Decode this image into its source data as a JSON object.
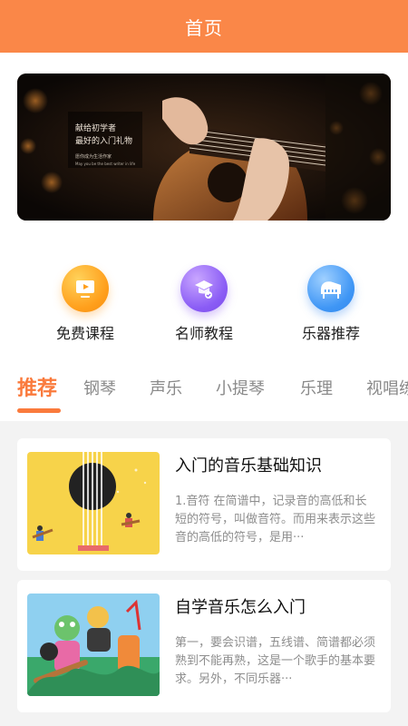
{
  "header": {
    "title": "首页"
  },
  "banner": {
    "line1": "献给初学者",
    "line2": "最好的入门礼物",
    "line3": "愿你成为生活作家",
    "line4": "May you be the best writer in life"
  },
  "categories": [
    {
      "label": "免费课程",
      "icon": "video-course-icon",
      "color": "#ffa11f"
    },
    {
      "label": "名师教程",
      "icon": "teacher-badge-icon",
      "color": "#8a5cf5"
    },
    {
      "label": "乐器推荐",
      "icon": "piano-icon",
      "color": "#3f96f5"
    }
  ],
  "tabs": [
    {
      "label": "推荐",
      "active": true
    },
    {
      "label": "钢琴"
    },
    {
      "label": "声乐"
    },
    {
      "label": "小提琴"
    },
    {
      "label": "乐理"
    },
    {
      "label": "视唱练"
    }
  ],
  "articles": [
    {
      "title": "入门的音乐基础知识",
      "desc": "1.音符 在简谱中，记录音的高低和长短的符号，叫做音符。而用来表示这些音的高低的符号，是用···"
    },
    {
      "title": "自学音乐怎么入门",
      "desc": "第一，要会识谱，五线谱、简谱都必须熟到不能再熟，这是一个歌手的基本要求。另外，不同乐器···"
    }
  ],
  "colors": {
    "accent": "#fa8748",
    "tab_active": "#fa7a3c"
  }
}
